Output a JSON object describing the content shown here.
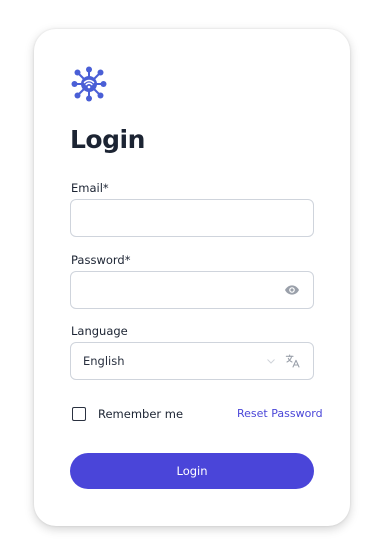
{
  "login": {
    "title": "Login",
    "email_label": "Email*",
    "email_value": "",
    "password_label": "Password*",
    "password_value": "",
    "language_label": "Language",
    "language_value": "English",
    "remember_label": "Remember me",
    "reset_link": "Reset Password",
    "submit_label": "Login"
  },
  "icons": {
    "logo": "network-hub-icon",
    "password_toggle": "eye-icon",
    "language_chevron": "chevron-down-icon",
    "language_translate": "translate-icon"
  },
  "colors": {
    "accent": "#4a45d9",
    "text": "#1c2433",
    "border": "#cfd4dc",
    "icon_gray": "#9aa0aa"
  }
}
